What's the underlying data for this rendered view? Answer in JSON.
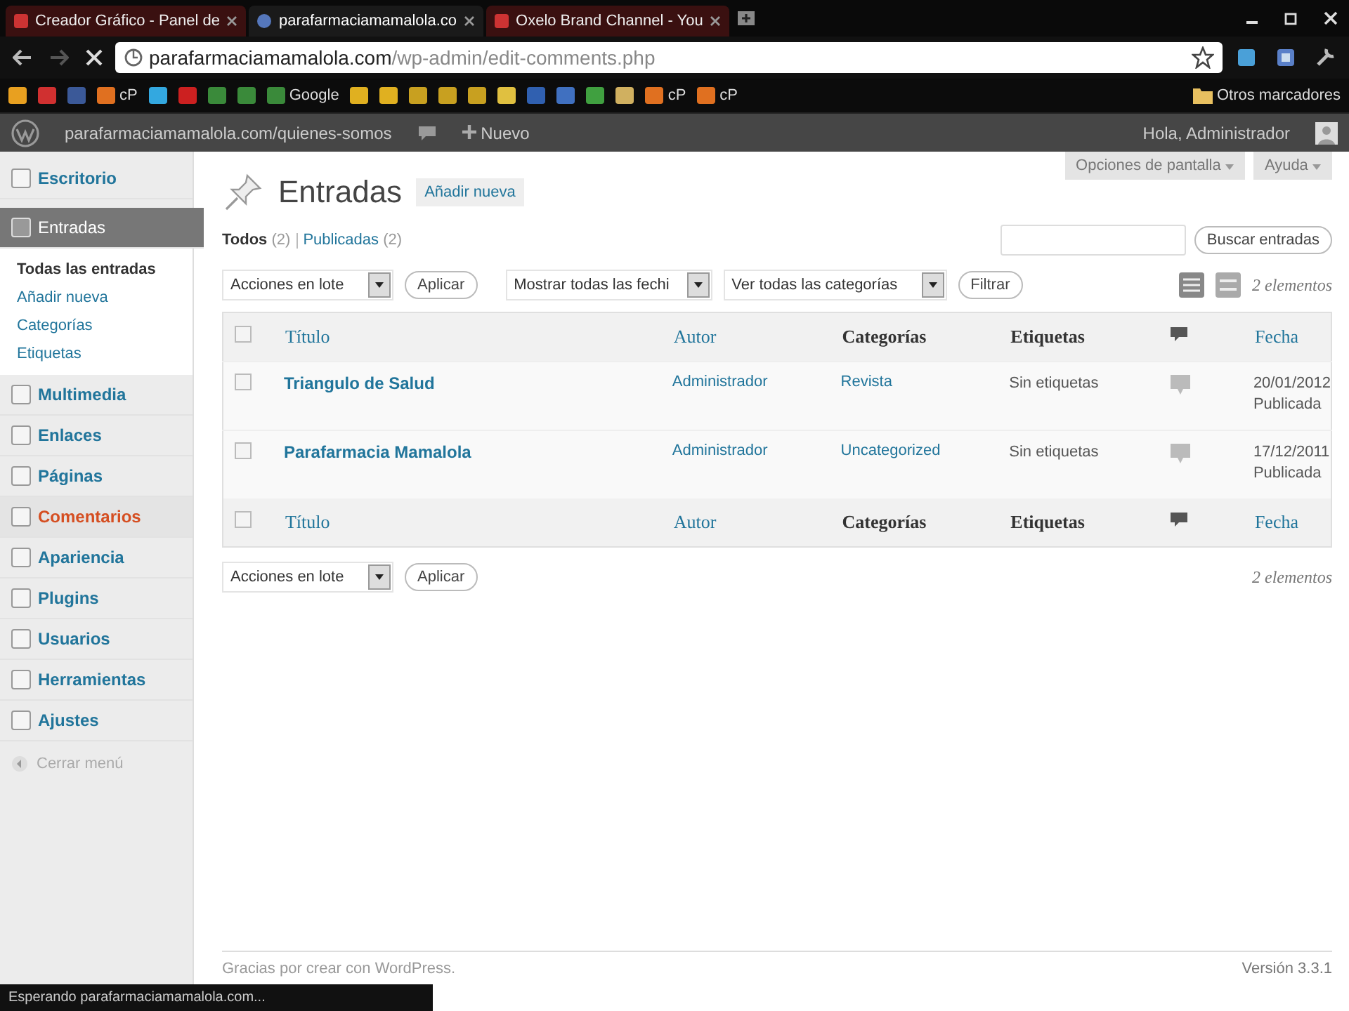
{
  "browser": {
    "tabs": [
      {
        "title": "Creador Gráfico - Panel de",
        "selected": false
      },
      {
        "title": "parafarmaciamamalola.co",
        "selected": true
      },
      {
        "title": "Oxelo Brand Channel - You",
        "selected": false
      }
    ],
    "url": {
      "host": "parafarmaciamamalola.com",
      "path": "/wp-admin/edit-comments.php"
    },
    "bookmarks": [
      {
        "color": "#e8a020"
      },
      {
        "color": "#d03030"
      },
      {
        "color": "#3b5998"
      },
      {
        "color": "#e07020",
        "label": "cP"
      },
      {
        "color": "#33a8e0"
      },
      {
        "color": "#cc2020"
      },
      {
        "color": "#3a8a3a"
      },
      {
        "color": "#3a8a3a"
      },
      {
        "color": "#3a8a3a",
        "label": "Google"
      },
      {
        "color": "#e0b020"
      },
      {
        "color": "#e0b020"
      },
      {
        "color": "#c8a020"
      },
      {
        "color": "#c8a020"
      },
      {
        "color": "#c8a020"
      },
      {
        "color": "#e0c040"
      },
      {
        "color": "#3060b0"
      },
      {
        "color": "#4070c0"
      },
      {
        "color": "#40a040"
      },
      {
        "color": "#d0b060"
      },
      {
        "color": "#e07020",
        "label": "cP"
      },
      {
        "color": "#e07020",
        "label": "cP"
      }
    ],
    "other_bookmarks": "Otros marcadores",
    "status": "Esperando parafarmaciamamalola.com..."
  },
  "admin_bar": {
    "site": "parafarmaciamamalola.com/quienes-somos",
    "new": "Nuevo",
    "greeting": "Hola, Administrador"
  },
  "sidebar": {
    "items": [
      {
        "label": "Escritorio",
        "selected": false,
        "hover": false
      },
      {
        "label": "Entradas",
        "selected": true,
        "hover": false,
        "children": [
          {
            "label": "Todas las entradas",
            "selected": true
          },
          {
            "label": "Añadir nueva",
            "selected": false
          },
          {
            "label": "Categorías",
            "selected": false
          },
          {
            "label": "Etiquetas",
            "selected": false
          }
        ]
      },
      {
        "label": "Multimedia",
        "selected": false,
        "hover": false
      },
      {
        "label": "Enlaces",
        "selected": false,
        "hover": false
      },
      {
        "label": "Páginas",
        "selected": false,
        "hover": false
      },
      {
        "label": "Comentarios",
        "selected": false,
        "hover": true
      },
      {
        "label": "Apariencia",
        "selected": false,
        "hover": false
      },
      {
        "label": "Plugins",
        "selected": false,
        "hover": false
      },
      {
        "label": "Usuarios",
        "selected": false,
        "hover": false
      },
      {
        "label": "Herramientas",
        "selected": false,
        "hover": false
      },
      {
        "label": "Ajustes",
        "selected": false,
        "hover": false
      }
    ],
    "collapse": "Cerrar menú"
  },
  "screen_options": [
    "Opciones de pantalla",
    "Ayuda"
  ],
  "page": {
    "title": "Entradas",
    "add_new": "Añadir nueva",
    "filters": [
      {
        "label": "Todos",
        "count": "(2)",
        "selected": true
      },
      {
        "label": "Publicadas",
        "count": "(2)",
        "selected": false
      }
    ],
    "search_button": "Buscar entradas",
    "bulk_action": "Acciones en lote",
    "apply": "Aplicar",
    "dates": "Mostrar todas las fechi",
    "categories": "Ver todas las categorías",
    "filter": "Filtrar",
    "count": "2 elementos",
    "bottom_bulk_action": "Acciones en lote",
    "bottom_apply": "Aplicar",
    "bottom_count": "2 elementos"
  },
  "table": {
    "select_all_checked": false,
    "footer_select_all_checked": false,
    "columns": [
      {
        "label": "Título",
        "kind": "text",
        "sortable": true
      },
      {
        "label": "Autor",
        "kind": "text",
        "sortable": true
      },
      {
        "label": "Categorías",
        "kind": "text",
        "sortable": false
      },
      {
        "label": "Etiquetas",
        "kind": "text",
        "sortable": false
      },
      {
        "kind": "comments"
      },
      {
        "label": "Fecha",
        "kind": "text",
        "sortable": true
      }
    ],
    "footer_columns": [
      {
        "label": "Título",
        "kind": "text",
        "sortable": true
      },
      {
        "label": "Autor",
        "kind": "text",
        "sortable": true
      },
      {
        "label": "Categorías",
        "kind": "text",
        "sortable": false
      },
      {
        "label": "Etiquetas",
        "kind": "text",
        "sortable": false
      },
      {
        "kind": "comments"
      },
      {
        "label": "Fecha",
        "kind": "text",
        "sortable": true
      }
    ],
    "rows": [
      {
        "title": "Triangulo de Salud",
        "author": "Administrador",
        "category": "Revista",
        "tags": "Sin etiquetas",
        "date": "20/01/2012",
        "status": "Publicada",
        "checked": false
      },
      {
        "title": "Parafarmacia Mamalola",
        "author": "Administrador",
        "category": "Uncategorized",
        "tags": "Sin etiquetas",
        "date": "17/12/2011",
        "status": "Publicada",
        "checked": false
      }
    ]
  },
  "footer": {
    "thanks": "Gracias por crear con WordPress.",
    "version": "Versión 3.3.1"
  }
}
